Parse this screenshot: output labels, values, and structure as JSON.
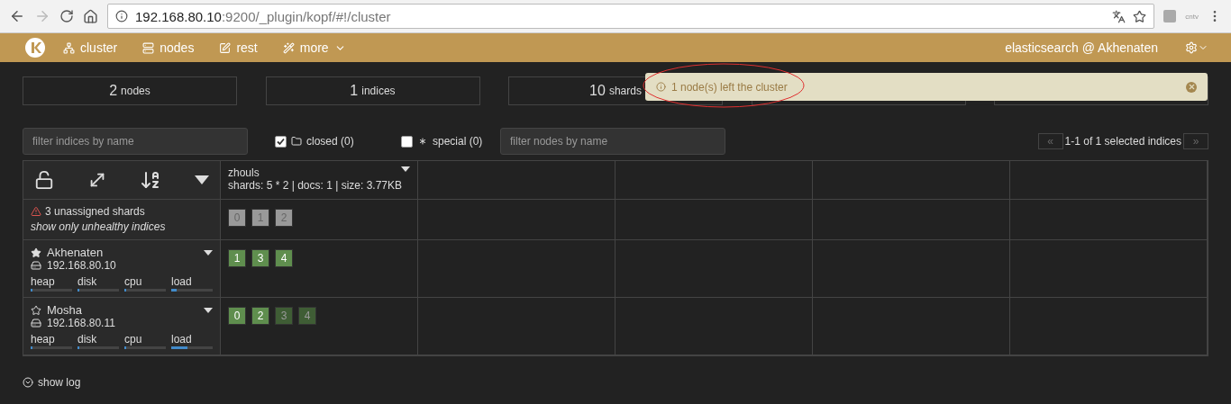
{
  "browser": {
    "url_host": "192.168.80.10",
    "url_path": ":9200/_plugin/kopf/#!/cluster",
    "extension_label": "cntv"
  },
  "navbar": {
    "items": [
      {
        "label": "cluster",
        "kind": "link"
      },
      {
        "label": "nodes",
        "kind": "link"
      },
      {
        "label": "rest",
        "kind": "link"
      },
      {
        "label": "more",
        "kind": "dropdown"
      }
    ],
    "cluster_name": "elasticsearch @ Akhenaten"
  },
  "stats": [
    {
      "value": "2",
      "unit": "nodes"
    },
    {
      "value": "1",
      "unit": "indices"
    },
    {
      "value": "10",
      "unit": "shards"
    }
  ],
  "notification": {
    "text": "1 node(s) left the cluster"
  },
  "filters": {
    "indices_placeholder": "filter indices by name",
    "closed": {
      "label": "closed (0)",
      "checked": true
    },
    "special": {
      "label": "special (0)",
      "checked": false
    },
    "nodes_placeholder": "filter nodes by name",
    "pager": "1-1 of 1 selected indices",
    "prev": "«",
    "next": "»"
  },
  "index": {
    "name": "zhouls",
    "details": "shards: 5 * 2 | docs: 1 | size: 3.77KB"
  },
  "unassigned": {
    "text": "3 unassigned shards",
    "link": "show only unhealthy indices",
    "shards": [
      {
        "label": "0",
        "kind": "unassigned"
      },
      {
        "label": "1",
        "kind": "unassigned"
      },
      {
        "label": "2",
        "kind": "unassigned"
      }
    ]
  },
  "nodes": [
    {
      "name": "Akhenaten",
      "ip": "192.168.80.10",
      "master": true,
      "meters": [
        {
          "label": "heap",
          "level": 0.05
        },
        {
          "label": "disk",
          "level": 0.05
        },
        {
          "label": "cpu",
          "level": 0.05
        },
        {
          "label": "load",
          "level": 0.14
        }
      ],
      "shards": [
        {
          "label": "1",
          "kind": "primary"
        },
        {
          "label": "3",
          "kind": "primary"
        },
        {
          "label": "4",
          "kind": "primary"
        }
      ]
    },
    {
      "name": "Mosha",
      "ip": "192.168.80.11",
      "master": false,
      "meters": [
        {
          "label": "heap",
          "level": 0.05
        },
        {
          "label": "disk",
          "level": 0.05
        },
        {
          "label": "cpu",
          "level": 0.05
        },
        {
          "label": "load",
          "level": 0.4
        }
      ],
      "shards": [
        {
          "label": "0",
          "kind": "primary"
        },
        {
          "label": "2",
          "kind": "primary"
        },
        {
          "label": "3",
          "kind": "replica"
        },
        {
          "label": "4",
          "kind": "replica"
        }
      ]
    }
  ],
  "show_log": "show log"
}
